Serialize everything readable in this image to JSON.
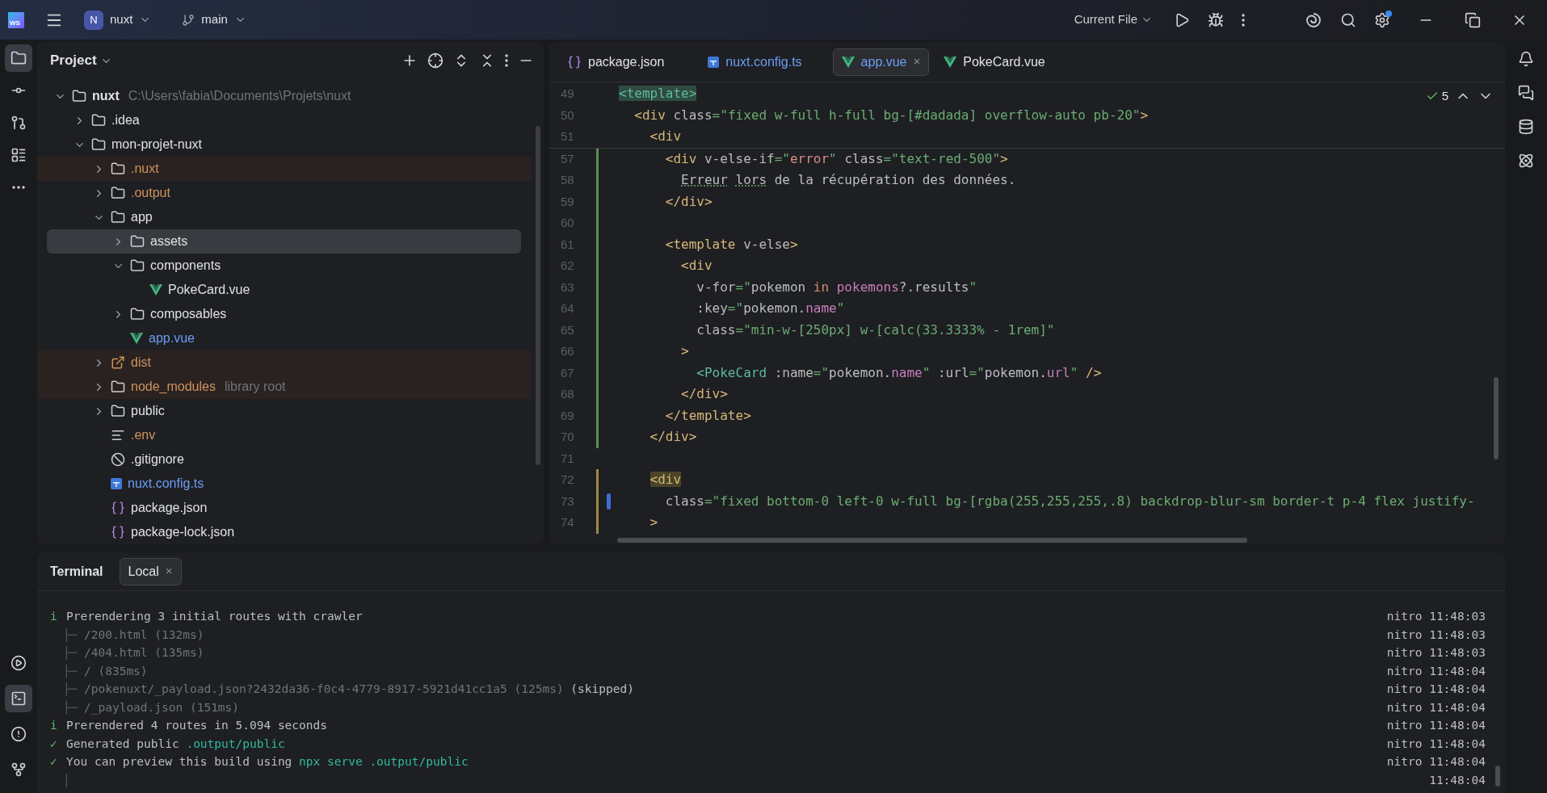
{
  "title_bar": {
    "logo": "WS",
    "project": {
      "initial": "N",
      "name": "nuxt"
    },
    "branch": "main",
    "run_config": "Current File"
  },
  "left_toolbar": {
    "top": [
      {
        "selected": true
      },
      {
        "selected": false
      },
      {
        "selected": false
      },
      {
        "selected": false
      },
      {
        "selected": false
      }
    ],
    "bottom": [
      {
        "selected": false
      },
      {
        "selected": true
      },
      {
        "selected": false
      },
      {
        "selected": false
      }
    ]
  },
  "project": {
    "title": "Project",
    "tree": [
      {
        "name": "nuxt",
        "kind": "project-root",
        "hint": "C:\\Users\\fabia\\Documents\\Projets\\nuxt",
        "expanded": true,
        "selected": false,
        "excluded": false,
        "ignored": false,
        "modified": false,
        "children": [
          {
            "name": ".idea",
            "kind": "folder",
            "expanded": false,
            "selected": false,
            "excluded": false,
            "ignored": false,
            "modified": false
          },
          {
            "name": "mon-projet-nuxt",
            "kind": "folder",
            "expanded": true,
            "selected": false,
            "excluded": false,
            "ignored": false,
            "modified": false,
            "children": [
              {
                "name": ".nuxt",
                "kind": "folder",
                "expanded": false,
                "selected": false,
                "excluded": true,
                "ignored": true,
                "modified": false
              },
              {
                "name": ".output",
                "kind": "folder",
                "expanded": false,
                "selected": false,
                "excluded": false,
                "ignored": true,
                "modified": false
              },
              {
                "name": "app",
                "kind": "folder",
                "expanded": true,
                "selected": false,
                "excluded": false,
                "ignored": false,
                "modified": false,
                "children": [
                  {
                    "name": "assets",
                    "kind": "folder",
                    "expanded": false,
                    "selected": true,
                    "excluded": false,
                    "ignored": false,
                    "modified": false
                  },
                  {
                    "name": "components",
                    "kind": "folder",
                    "expanded": true,
                    "selected": false,
                    "excluded": false,
                    "ignored": false,
                    "modified": false,
                    "children": [
                      {
                        "name": "PokeCard.vue",
                        "kind": "vue",
                        "selected": false,
                        "excluded": false,
                        "ignored": false,
                        "modified": false
                      }
                    ]
                  },
                  {
                    "name": "composables",
                    "kind": "folder",
                    "expanded": false,
                    "selected": false,
                    "excluded": false,
                    "ignored": false,
                    "modified": false
                  },
                  {
                    "name": "app.vue",
                    "kind": "vue",
                    "selected": false,
                    "excluded": false,
                    "ignored": false,
                    "modified": true
                  }
                ]
              },
              {
                "name": "dist",
                "kind": "folder-link",
                "expanded": false,
                "selected": false,
                "excluded": true,
                "ignored": true,
                "modified": false
              },
              {
                "name": "node_modules",
                "kind": "folder",
                "hint": "library root",
                "expanded": false,
                "selected": false,
                "excluded": true,
                "ignored": true,
                "modified": false
              },
              {
                "name": "public",
                "kind": "folder",
                "expanded": false,
                "selected": false,
                "excluded": false,
                "ignored": false,
                "modified": false
              },
              {
                "name": ".env",
                "kind": "env",
                "selected": false,
                "excluded": false,
                "ignored": true,
                "modified": false
              },
              {
                "name": ".gitignore",
                "kind": "gitignore",
                "selected": false,
                "excluded": false,
                "ignored": false,
                "modified": false
              },
              {
                "name": "nuxt.config.ts",
                "kind": "ts",
                "selected": false,
                "excluded": false,
                "ignored": false,
                "modified": true
              },
              {
                "name": "package.json",
                "kind": "json",
                "selected": false,
                "excluded": false,
                "ignored": false,
                "modified": false
              },
              {
                "name": "package-lock.json",
                "kind": "json",
                "selected": false,
                "excluded": false,
                "ignored": false,
                "modified": false
              }
            ]
          }
        ]
      }
    ]
  },
  "editor": {
    "tabs": [
      {
        "label": "package.json",
        "kind": "json",
        "modified": false,
        "selected": false
      },
      {
        "label": "nuxt.config.ts",
        "kind": "ts",
        "modified": true,
        "selected": false
      },
      {
        "label": "app.vue",
        "kind": "vue",
        "modified": true,
        "selected": true,
        "close": "×"
      },
      {
        "label": "PokeCard.vue",
        "kind": "vue",
        "modified": false,
        "selected": false
      }
    ],
    "inspections": "5",
    "sticky_lines": [
      {
        "number": "49",
        "tokens": [
          {
            "text": "<template>",
            "kind": "match"
          }
        ]
      },
      {
        "number": "50",
        "tokens": [
          {
            "text": "  <div",
            "kind": "tag"
          },
          {
            "text": " class",
            "kind": "attr"
          },
          {
            "text": "=\"fixed w-full h-full bg-[#dadada] overflow-auto pb-20\"",
            "kind": "str"
          },
          {
            "text": ">",
            "kind": "tag"
          }
        ]
      },
      {
        "number": "51",
        "tokens": [
          {
            "text": "    <div",
            "kind": "tag"
          }
        ]
      }
    ],
    "lines": [
      {
        "number": "57",
        "kind": "added",
        "tokens": [
          {
            "text": "      <div",
            "kind": "tag"
          },
          {
            "text": " v-else-if",
            "kind": "attr"
          },
          {
            "text": "=\"",
            "kind": "str"
          },
          {
            "text": "error",
            "kind": "expr"
          },
          {
            "text": "\"",
            "kind": "str"
          },
          {
            "text": " class",
            "kind": "attr"
          },
          {
            "text": "=\"text-red-500\"",
            "kind": "str"
          },
          {
            "text": ">",
            "kind": "tag"
          }
        ]
      },
      {
        "number": "58",
        "kind": "added",
        "tokens": [
          {
            "text": "        Erreur",
            "kind": "typo"
          },
          {
            "text": " lors",
            "kind": "typo"
          },
          {
            "text": " de la récupération des données.",
            "kind": "plain"
          }
        ]
      },
      {
        "number": "59",
        "kind": "added",
        "tokens": [
          {
            "text": "      </div>",
            "kind": "tag"
          }
        ]
      },
      {
        "number": "60",
        "kind": "added"
      },
      {
        "number": "61",
        "kind": "added",
        "tokens": [
          {
            "text": "      <template",
            "kind": "tag"
          },
          {
            "text": " v-else",
            "kind": "attr"
          },
          {
            "text": ">",
            "kind": "tag"
          }
        ]
      },
      {
        "number": "62",
        "kind": "added",
        "tokens": [
          {
            "text": "        <div",
            "kind": "tag"
          }
        ]
      },
      {
        "number": "63",
        "kind": "added",
        "tokens": [
          {
            "text": "          v-for",
            "kind": "attr"
          },
          {
            "text": "=\"",
            "kind": "str"
          },
          {
            "text": "pokemon ",
            "kind": "plain"
          },
          {
            "text": "in ",
            "kind": "kw"
          },
          {
            "text": "pokemons",
            "kind": "prop"
          },
          {
            "text": "?.results",
            "kind": "plain"
          },
          {
            "text": "\"",
            "kind": "str"
          }
        ]
      },
      {
        "number": "64",
        "kind": "added",
        "tokens": [
          {
            "text": "          :key",
            "kind": "attr"
          },
          {
            "text": "=\"",
            "kind": "str"
          },
          {
            "text": "pokemon.",
            "kind": "plain"
          },
          {
            "text": "name",
            "kind": "prop"
          },
          {
            "text": "\"",
            "kind": "str"
          }
        ]
      },
      {
        "number": "65",
        "kind": "added",
        "tokens": [
          {
            "text": "          class",
            "kind": "attr"
          },
          {
            "text": "=\"min-w-[250px] w-[calc(33.3333% - 1rem]\"",
            "kind": "str"
          }
        ]
      },
      {
        "number": "66",
        "kind": "added",
        "tokens": [
          {
            "text": "        >",
            "kind": "tag"
          }
        ]
      },
      {
        "number": "67",
        "kind": "added",
        "tokens": [
          {
            "text": "          <PokeCard",
            "kind": "comp"
          },
          {
            "text": " :name",
            "kind": "attr"
          },
          {
            "text": "=\"",
            "kind": "str"
          },
          {
            "text": "pokemon.",
            "kind": "plain"
          },
          {
            "text": "name",
            "kind": "prop"
          },
          {
            "text": "\"",
            "kind": "str"
          },
          {
            "text": " :url",
            "kind": "attr"
          },
          {
            "text": "=\"",
            "kind": "str"
          },
          {
            "text": "pokemon.",
            "kind": "plain"
          },
          {
            "text": "url",
            "kind": "prop"
          },
          {
            "text": "\"",
            "kind": "str"
          },
          {
            "text": " />",
            "kind": "tag"
          }
        ]
      },
      {
        "number": "68",
        "kind": "added",
        "tokens": [
          {
            "text": "        </div>",
            "kind": "tag"
          }
        ]
      },
      {
        "number": "69",
        "kind": "added",
        "tokens": [
          {
            "text": "      </template>",
            "kind": "tag"
          }
        ]
      },
      {
        "number": "70",
        "kind": "added",
        "tokens": [
          {
            "text": "    </div>",
            "kind": "tag"
          }
        ]
      },
      {
        "number": "71",
        "kind": "none"
      },
      {
        "number": "72",
        "kind": "modified",
        "tokens": [
          {
            "text": "    <div",
            "kind": "usage"
          }
        ]
      },
      {
        "number": "73",
        "kind": "modified",
        "caret": true,
        "tokens": [
          {
            "text": "      class",
            "kind": "attr"
          },
          {
            "text": "=\"fixed bottom-0 left-0 w-full bg-[rgba(255,255,255,.8) backdrop-blur-sm border-t p-4 flex justify-",
            "kind": "str"
          }
        ]
      },
      {
        "number": "74",
        "kind": "modified",
        "tokens": [
          {
            "text": "    >",
            "kind": "tag"
          }
        ]
      }
    ]
  },
  "terminal": {
    "title": "Terminal",
    "tabs": [
      {
        "label": "Local",
        "close": "×",
        "selected": true
      }
    ],
    "lines": [
      {
        "kind": "info",
        "prefix": "i",
        "tokens": [
          {
            "text": "Prerendering 3 initial routes with crawler",
            "kind": "plain"
          }
        ],
        "source": "nitro 11:48:03"
      },
      {
        "kind": "detail",
        "prefix": "├─",
        "tokens": [
          {
            "text": "/200.html (132ms)",
            "kind": "dim"
          }
        ],
        "source": "nitro 11:48:03"
      },
      {
        "kind": "detail",
        "prefix": "├─",
        "tokens": [
          {
            "text": "/404.html (135ms)",
            "kind": "dim"
          }
        ],
        "source": "nitro 11:48:03"
      },
      {
        "kind": "detail",
        "prefix": "├─",
        "tokens": [
          {
            "text": "/ (835ms)",
            "kind": "dim"
          }
        ],
        "source": "nitro 11:48:04"
      },
      {
        "kind": "detail",
        "prefix": "├─",
        "tokens": [
          {
            "text": "/pokenuxt/_payload.json?2432da36-f0c4-4779-8917-5921d41cc1a5 (125ms) ",
            "kind": "dim"
          },
          {
            "text": "(skipped)",
            "kind": "plain"
          }
        ],
        "source": "nitro 11:48:04"
      },
      {
        "kind": "detail",
        "prefix": "├─",
        "tokens": [
          {
            "text": "/_payload.json (151ms)",
            "kind": "dim"
          }
        ],
        "source": "nitro 11:48:04"
      },
      {
        "kind": "info",
        "prefix": "i",
        "tokens": [
          {
            "text": "Prerendered 4 routes in 5.094 seconds",
            "kind": "plain"
          }
        ],
        "source": "nitro 11:48:04"
      },
      {
        "kind": "success",
        "prefix": "✓",
        "tokens": [
          {
            "text": "Generated public ",
            "kind": "plain"
          },
          {
            "text": ".output/public",
            "kind": "accent"
          }
        ],
        "source": "nitro 11:48:04"
      },
      {
        "kind": "success",
        "prefix": "✓",
        "tokens": [
          {
            "text": "You can preview this build using ",
            "kind": "plain"
          },
          {
            "text": "npx serve .output/public",
            "kind": "accent"
          }
        ],
        "source": "nitro 11:48:04"
      },
      {
        "kind": "detail",
        "prefix": "│",
        "source": "11:48:04"
      }
    ]
  }
}
